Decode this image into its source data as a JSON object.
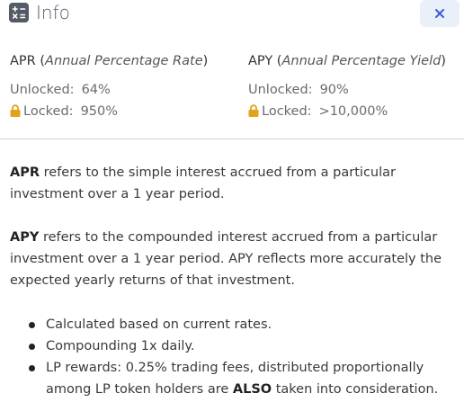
{
  "header": {
    "title": "Info",
    "icon": "calculator-icon",
    "close_icon": "close-icon",
    "accent_color": "#3b5cd6"
  },
  "apr": {
    "label": "APR",
    "open": " (",
    "subtitle": "Annual Percentage Rate",
    "close": ")",
    "unlocked_label": "Unlocked:",
    "unlocked_value": "64%",
    "locked_label": "Locked:",
    "locked_value": "950%"
  },
  "apy": {
    "label": "APY",
    "open": " (",
    "subtitle": "Annual Percentage Yield",
    "close": ")",
    "unlocked_label": "Unlocked:",
    "unlocked_value": "90%",
    "locked_label": "Locked:",
    "locked_value": ">10,000%"
  },
  "lock_color": "#e3a21a",
  "description": {
    "apr_term": "APR",
    "apr_text": " refers to the simple interest accrued from a particular investment over a 1 year period.",
    "apy_term": "APY",
    "apy_text": " refers to the compounded interest accrued from a particular investment over a 1 year period. APY reflects more accurately the expected yearly returns of that investment."
  },
  "bullets": {
    "item1": "Calculated based on current rates.",
    "item2": "Compounding 1x daily.",
    "item3_before": "LP rewards: 0.25% trading fees, distributed proportionally among LP token holders are ",
    "item3_bold": "ALSO",
    "item3_after": " taken into consideration."
  }
}
